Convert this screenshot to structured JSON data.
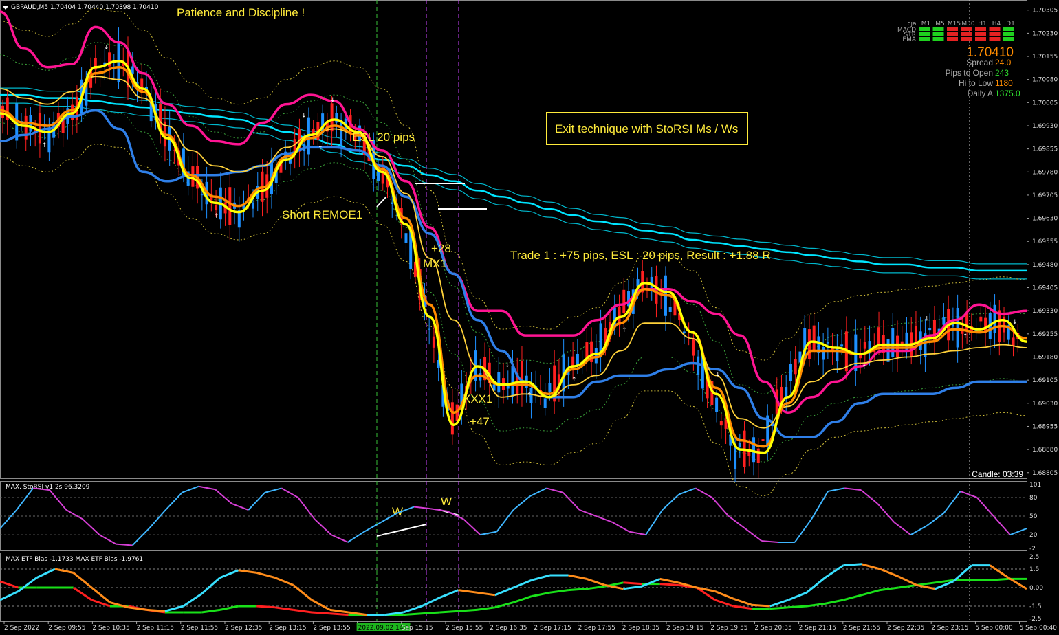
{
  "window": {
    "symbol_header": "GBPAUD,M5  1.70404 1.70440 1.70398 1.70410"
  },
  "colors": {
    "background": "#000000",
    "bull": "#1E90FF",
    "bear": "#FF2020",
    "yellow": "#FFFF00",
    "orange": "#FF8C00",
    "magenta": "#FF1493",
    "cyan": "#00E5FF",
    "text_yellow": "#FFEB3B",
    "green": "#00E000",
    "violet": "#CC44FF"
  },
  "annotations": {
    "patience": "Patience and Discipline !",
    "esl": "ESL 20 pips",
    "short_entry": "Short REMOE1",
    "plus28": "+28",
    "mx1": "MX1",
    "xxx1": "XXX1",
    "plus47": "+47",
    "exit_box": "Exit technique with StoRSI Ms / Ws",
    "trade_result": "Trade 1 : +75 pips, ESL : 20 pips, Result : +1.88 R",
    "w_left": "W",
    "w_right": "W"
  },
  "info_panel": {
    "price": "1.70410",
    "rows": [
      {
        "label": "Spread",
        "value": "24.0"
      },
      {
        "label": "Pips to Open",
        "value": "243"
      },
      {
        "label": "Hi to Low",
        "value": "1180"
      },
      {
        "label": "Daily A",
        "value": "1375.0"
      }
    ],
    "candle_timer": "Candle: 03:39",
    "matrix_cols": [
      "cja",
      "M1",
      "M5",
      "M15",
      "M30",
      "H1",
      "H4",
      "D1"
    ],
    "matrix_rows": [
      {
        "name": "MACD",
        "cells": [
          "green",
          "green",
          "red",
          "red",
          "red",
          "red",
          "green"
        ]
      },
      {
        "name": "STR",
        "cells": [
          "green",
          "green",
          "red",
          "red",
          "red",
          "red",
          "green"
        ]
      },
      {
        "name": "EMA",
        "cells": [
          "green",
          "green",
          "red",
          "red",
          "red",
          "red",
          "green"
        ]
      }
    ]
  },
  "chart_data": [
    {
      "type": "line",
      "title": "GBPAUD,M5",
      "price_ticks": [
        "1.70305",
        "1.70230",
        "1.70155",
        "1.70080",
        "1.70005",
        "1.69930",
        "1.69855",
        "1.69780",
        "1.69705",
        "1.69630",
        "1.69555",
        "1.69480",
        "1.69405",
        "1.69330",
        "1.69255",
        "1.69180",
        "1.69105",
        "1.69030",
        "1.68955",
        "1.68880",
        "1.68805"
      ],
      "ylim": [
        1.688,
        1.7032
      ],
      "x_labels": [
        "2 Sep 2022",
        "2 Sep 09:55",
        "2 Sep 10:35",
        "2 Sep 11:15",
        "2 Sep 11:55",
        "2 Sep 12:35",
        "2 Sep 13:15",
        "2 Sep 13:55",
        "2022.09.02 14:55",
        "Sep 15:15",
        "2 Sep 15:55",
        "2 Sep 16:35",
        "2 Sep 17:15",
        "2 Sep 17:55",
        "2 Sep 18:35",
        "2 Sep 19:15",
        "2 Sep 19:55",
        "2 Sep 20:35",
        "2 Sep 21:15",
        "2 Sep 21:55",
        "2 Sep 22:35",
        "2 Sep 23:15",
        "5 Sep 00:00",
        "5 Sep 00:40"
      ],
      "series": [
        {
          "values": [
            1.6997,
            1.6993,
            1.6991,
            1.6997,
            1.7012,
            1.7014,
            1.7005,
            1.6989,
            1.6976,
            1.6968,
            1.6965,
            1.6972,
            1.6982,
            1.699,
            1.6995,
            1.6991,
            1.6978,
            1.6961,
            1.6931,
            1.6896,
            1.6915,
            1.6909,
            1.691,
            1.6905,
            1.6915,
            1.6919,
            1.6931,
            1.6942,
            1.6939,
            1.6926,
            1.6906,
            1.6888,
            1.6887,
            1.6905,
            1.6923,
            1.6921,
            1.6919,
            1.6922,
            1.6922,
            1.6924,
            1.6929,
            1.6927,
            1.693,
            1.6923
          ]
        },
        {
          "values": [
            1.6998,
            1.6994,
            1.6993,
            1.6998,
            1.701,
            1.7012,
            1.7004,
            1.699,
            1.6977,
            1.697,
            1.6967,
            1.6973,
            1.6983,
            1.6989,
            1.6993,
            1.699,
            1.6979,
            1.6963,
            1.6935,
            1.69,
            1.6912,
            1.6909,
            1.6909,
            1.6906,
            1.6914,
            1.6918,
            1.6929,
            1.694,
            1.6938,
            1.6926,
            1.6908,
            1.6891,
            1.6889,
            1.6903,
            1.692,
            1.692,
            1.6919,
            1.6921,
            1.6921,
            1.6923,
            1.6927,
            1.6926,
            1.6928,
            1.6924
          ]
        },
        {
          "values": [
            1.7005,
            1.7002,
            1.7,
            1.7004,
            1.7009,
            1.7008,
            1.7002,
            1.6993,
            1.6985,
            1.698,
            1.6978,
            1.698,
            1.6986,
            1.699,
            1.6992,
            1.699,
            1.6983,
            1.6971,
            1.695,
            1.693,
            1.6915,
            1.6905,
            1.6906,
            1.6905,
            1.6909,
            1.6912,
            1.692,
            1.6929,
            1.6929,
            1.6924,
            1.6912,
            1.6898,
            1.6895,
            1.6902,
            1.691,
            1.6914,
            1.6916,
            1.6917,
            1.6918,
            1.6919,
            1.692,
            1.6921,
            1.6922,
            1.6921
          ]
        },
        {
          "values": [
            1.703,
            1.7018,
            1.7012,
            1.7013,
            1.7025,
            1.702,
            1.701,
            1.7,
            1.6993,
            1.6988,
            1.6987,
            1.6994,
            1.7,
            1.7003,
            1.7001,
            1.6992,
            1.6985,
            1.6975,
            1.696,
            1.6945,
            1.6933,
            1.6933,
            1.6925,
            1.6925,
            1.6925,
            1.693,
            1.6935,
            1.694,
            1.694,
            1.6936,
            1.6932,
            1.6925,
            1.691,
            1.69,
            1.6905,
            1.691,
            1.6915,
            1.692,
            1.692,
            1.6925,
            1.693,
            1.6935,
            1.6932,
            1.6933
          ]
        },
        {
          "values": [
            1.6988,
            1.699,
            1.6992,
            1.6996,
            1.6998,
            1.6992,
            1.6978,
            1.6975,
            1.6977,
            1.6977,
            1.6978,
            1.698,
            1.6984,
            1.6986,
            1.6986,
            1.6985,
            1.698,
            1.697,
            1.6958,
            1.6945,
            1.693,
            1.692,
            1.691,
            1.6905,
            1.6905,
            1.691,
            1.6912,
            1.6912,
            1.6914,
            1.6916,
            1.6914,
            1.6908,
            1.6898,
            1.6892,
            1.6892,
            1.6897,
            1.6903,
            1.6906,
            1.6906,
            1.6906,
            1.6908,
            1.691,
            1.691,
            1.691
          ]
        },
        {
          "values": [
            1.7003,
            1.7003,
            1.7002,
            1.7002,
            1.7001,
            1.7,
            1.6999,
            1.6998,
            1.6997,
            1.6996,
            1.6995,
            1.6993,
            1.6991,
            1.6989,
            1.6987,
            1.6984,
            1.6982,
            1.698,
            1.6977,
            1.6975,
            1.6972,
            1.697,
            1.6968,
            1.6966,
            1.6964,
            1.6962,
            1.6961,
            1.6959,
            1.6958,
            1.6956,
            1.6955,
            1.6954,
            1.6953,
            1.6952,
            1.6951,
            1.695,
            1.6949,
            1.6948,
            1.6948,
            1.6947,
            1.6947,
            1.6946,
            1.6946,
            1.6946
          ]
        }
      ]
    },
    {
      "type": "line",
      "title": "MAX. StoRSI v1.2s 96.3209",
      "ticks": [
        "101",
        "80",
        "50",
        "20",
        "-2"
      ],
      "ylim": [
        -2,
        101
      ],
      "series": [
        {
          "values": [
            30,
            60,
            95,
            92,
            60,
            45,
            20,
            5,
            3,
            30,
            60,
            88,
            98,
            93,
            70,
            60,
            88,
            95,
            80,
            45,
            20,
            8,
            25,
            40,
            55,
            65,
            62,
            58,
            45,
            20,
            25,
            60,
            82,
            95,
            88,
            60,
            50,
            40,
            25,
            20,
            60,
            85,
            95,
            80,
            50,
            30,
            10,
            8,
            8,
            45,
            90,
            95,
            92,
            70,
            40,
            20,
            35,
            55,
            90,
            80,
            50,
            20,
            30
          ]
        }
      ]
    },
    {
      "type": "line",
      "title": "MAX ETF Bias -1.1733  MAX ETF Bias -1.9761",
      "ticks": [
        "2.5",
        "1.5",
        "0.00",
        "-1.5",
        "-2.5"
      ],
      "ylim": [
        -2.5,
        2.5
      ],
      "series": [
        {
          "values": [
            -1.0,
            -0.3,
            0.8,
            1.5,
            1.2,
            0.0,
            -1.2,
            -1.6,
            -1.8,
            -1.9,
            -1.5,
            -0.5,
            0.8,
            1.4,
            1.2,
            0.8,
            0.2,
            -1.0,
            -1.8,
            -2.0,
            -2.2,
            -2.2,
            -2.0,
            -1.5,
            -0.8,
            -0.2,
            -0.4,
            -0.6,
            0.0,
            0.6,
            1.0,
            1.0,
            0.7,
            0.2,
            -0.1,
            0.1,
            0.7,
            0.4,
            0.0,
            -0.3,
            -0.9,
            -1.4,
            -1.5,
            -1.0,
            -0.4,
            0.8,
            1.8,
            1.9,
            1.5,
            0.9,
            0.2,
            -0.1,
            0.5,
            1.8,
            1.8,
            0.8,
            -0.1
          ]
        },
        {
          "values": [
            0.5,
            0.0,
            0.0,
            0.0,
            0.0,
            -1.0,
            -1.5,
            -1.5,
            -1.8,
            -2.0,
            -2.0,
            -2.0,
            -1.8,
            -1.5,
            -1.5,
            -1.6,
            -1.8,
            -2.0,
            -2.1,
            -2.2,
            -2.2,
            -2.2,
            -2.2,
            -2.1,
            -2.0,
            -1.9,
            -1.8,
            -1.6,
            -1.2,
            -0.7,
            -0.4,
            -0.2,
            -0.1,
            0.1,
            0.4,
            0.3,
            0.3,
            0.2,
            0.0,
            -1.0,
            -1.5,
            -1.7,
            -1.7,
            -1.6,
            -1.5,
            -1.3,
            -1.0,
            -0.6,
            -0.2,
            0.0,
            0.2,
            0.4,
            0.6,
            0.6,
            0.6,
            0.7,
            0.7
          ]
        }
      ]
    }
  ]
}
